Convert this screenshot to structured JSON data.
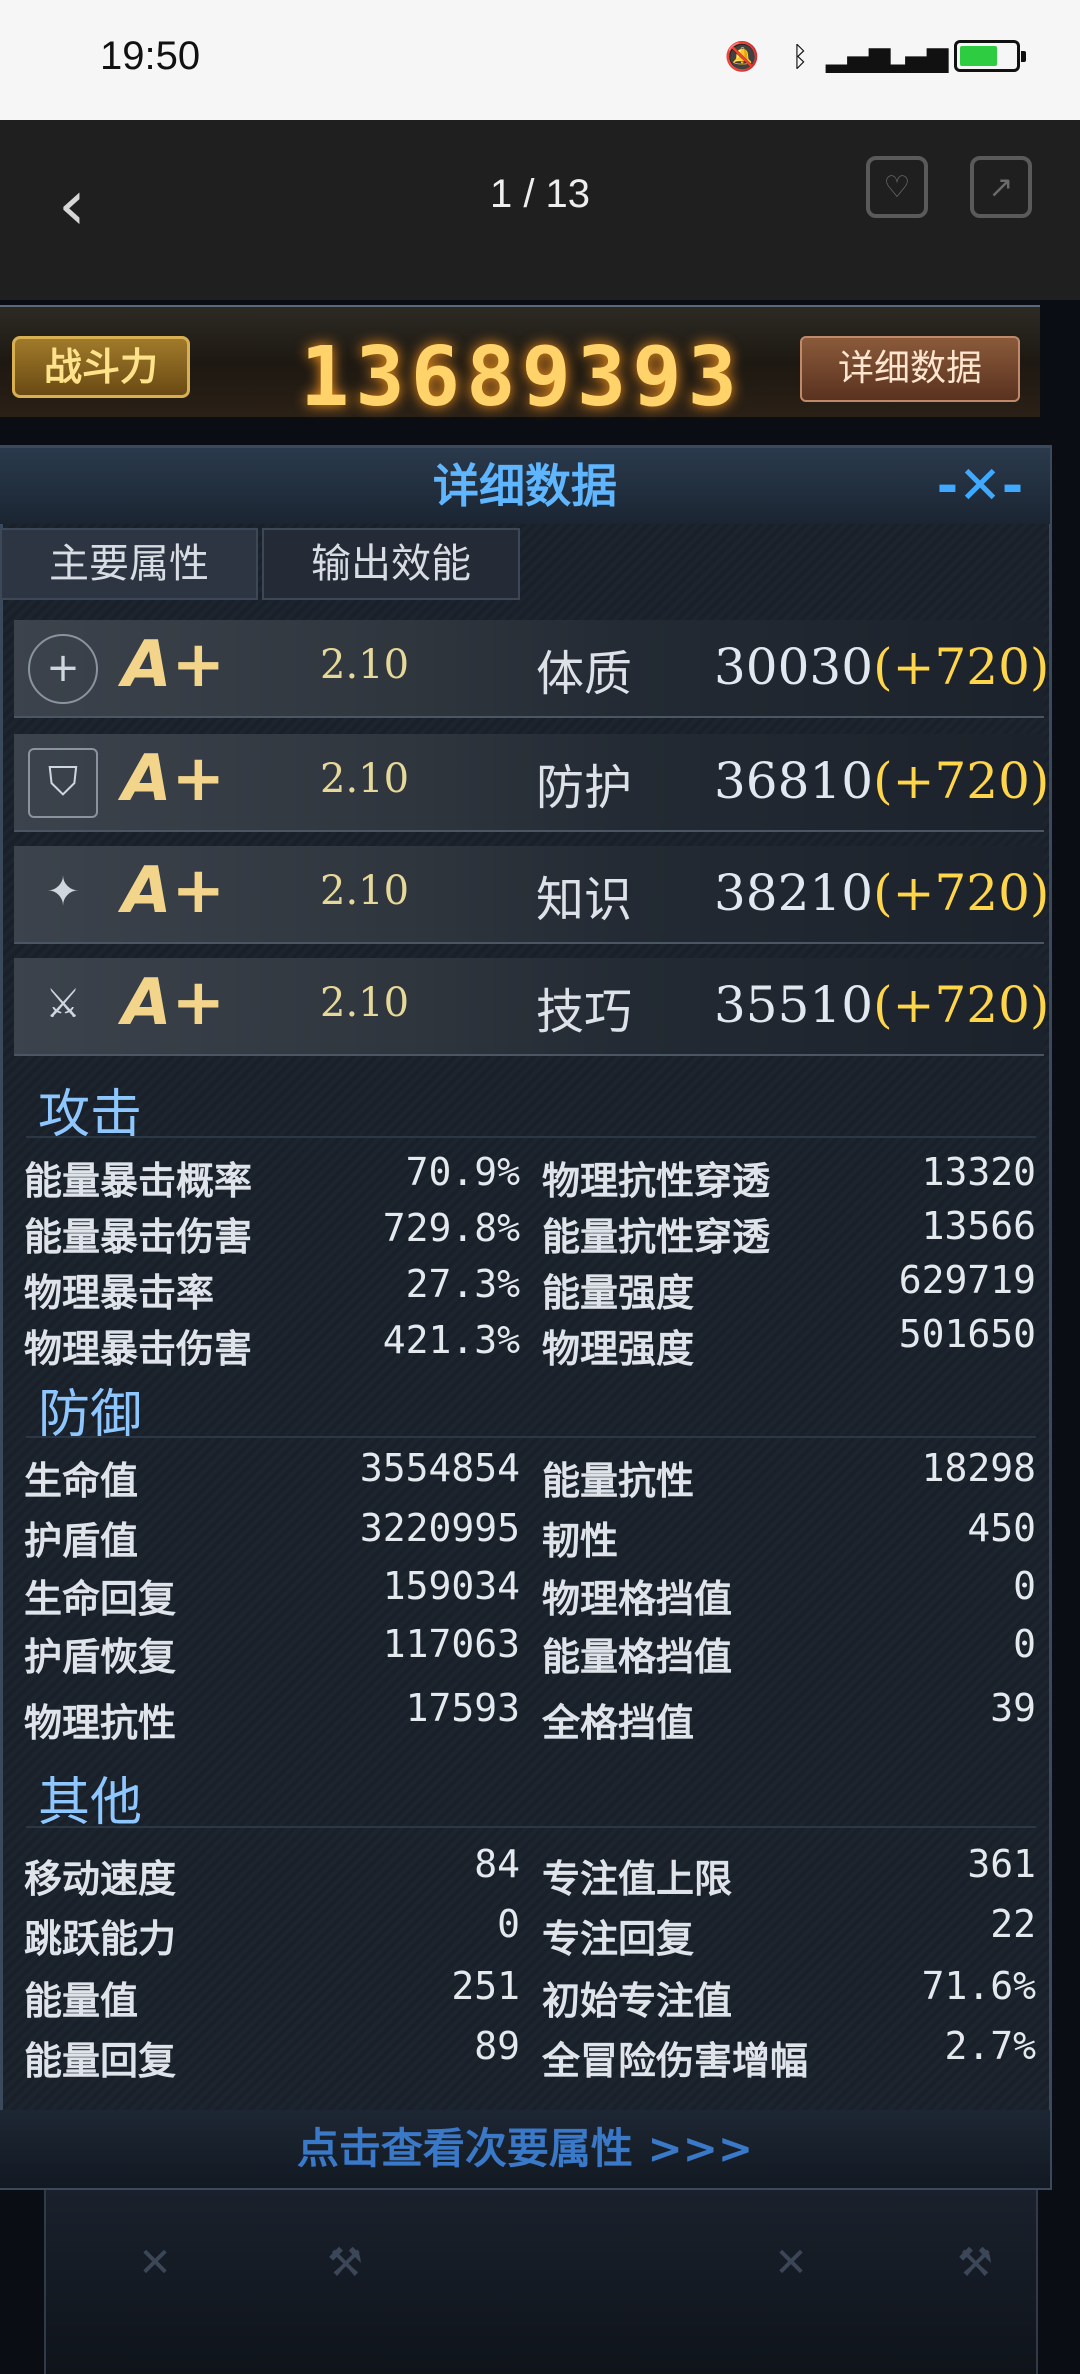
{
  "status_bar": {
    "time": "19:50",
    "icons": [
      "mute-bell-icon",
      "bluetooth-icon",
      "5g-signal-icon",
      "5g-signal-icon",
      "battery-charging-icon"
    ]
  },
  "viewer": {
    "counter": "1 / 13",
    "icons": [
      "back-icon",
      "save-image-icon",
      "share-icon"
    ]
  },
  "game": {
    "power_label": "战斗力",
    "power_value": "13689393",
    "detail_button": "详细数据",
    "panel_title": "详细数据",
    "tabs": [
      "主要属性",
      "输出效能"
    ],
    "attributes": [
      {
        "icon": "constitution-icon",
        "grade": "A+",
        "mult": "2.10",
        "name": "体质",
        "value": "30030",
        "bonus": "(+720)"
      },
      {
        "icon": "shield-icon",
        "grade": "A+",
        "mult": "2.10",
        "name": "防护",
        "value": "36810",
        "bonus": "(+720)"
      },
      {
        "icon": "knowledge-icon",
        "grade": "A+",
        "mult": "2.10",
        "name": "知识",
        "value": "38210",
        "bonus": "(+720)"
      },
      {
        "icon": "skill-icon",
        "grade": "A+",
        "mult": "2.10",
        "name": "技巧",
        "value": "35510",
        "bonus": "(+720)"
      }
    ],
    "sections": {
      "attack": {
        "title": "攻击",
        "left": [
          {
            "label": "能量暴击概率",
            "value": "70.9%"
          },
          {
            "label": "能量暴击伤害",
            "value": "729.8%"
          },
          {
            "label": "物理暴击率",
            "value": "27.3%"
          },
          {
            "label": "物理暴击伤害",
            "value": "421.3%"
          }
        ],
        "right": [
          {
            "label": "物理抗性穿透",
            "value": "13320"
          },
          {
            "label": "能量抗性穿透",
            "value": "13566"
          },
          {
            "label": "能量强度",
            "value": "629719"
          },
          {
            "label": "物理强度",
            "value": "501650"
          }
        ]
      },
      "defense": {
        "title": "防御",
        "left": [
          {
            "label": "生命值",
            "value": "3554854"
          },
          {
            "label": "护盾值",
            "value": "3220995"
          },
          {
            "label": "生命回复",
            "value": "159034"
          },
          {
            "label": "护盾恢复",
            "value": "117063"
          },
          {
            "label": "物理抗性",
            "value": "17593"
          }
        ],
        "right": [
          {
            "label": "能量抗性",
            "value": "18298"
          },
          {
            "label": "韧性",
            "value": "450"
          },
          {
            "label": "物理格挡值",
            "value": "0"
          },
          {
            "label": "能量格挡值",
            "value": "0"
          },
          {
            "label": "全格挡值",
            "value": "39"
          }
        ]
      },
      "other": {
        "title": "其他",
        "left": [
          {
            "label": "移动速度",
            "value": "84"
          },
          {
            "label": "跳跃能力",
            "value": "0"
          },
          {
            "label": "能量值",
            "value": "251"
          },
          {
            "label": "能量回复",
            "value": "89"
          }
        ],
        "right": [
          {
            "label": "专注值上限",
            "value": "361"
          },
          {
            "label": "专注回复",
            "value": "22"
          },
          {
            "label": "初始专注值",
            "value": "71.6%"
          },
          {
            "label": "全冒险伤害增幅",
            "value": "2.7%"
          }
        ]
      }
    },
    "footer": "点击查看次要属性 >>>"
  }
}
